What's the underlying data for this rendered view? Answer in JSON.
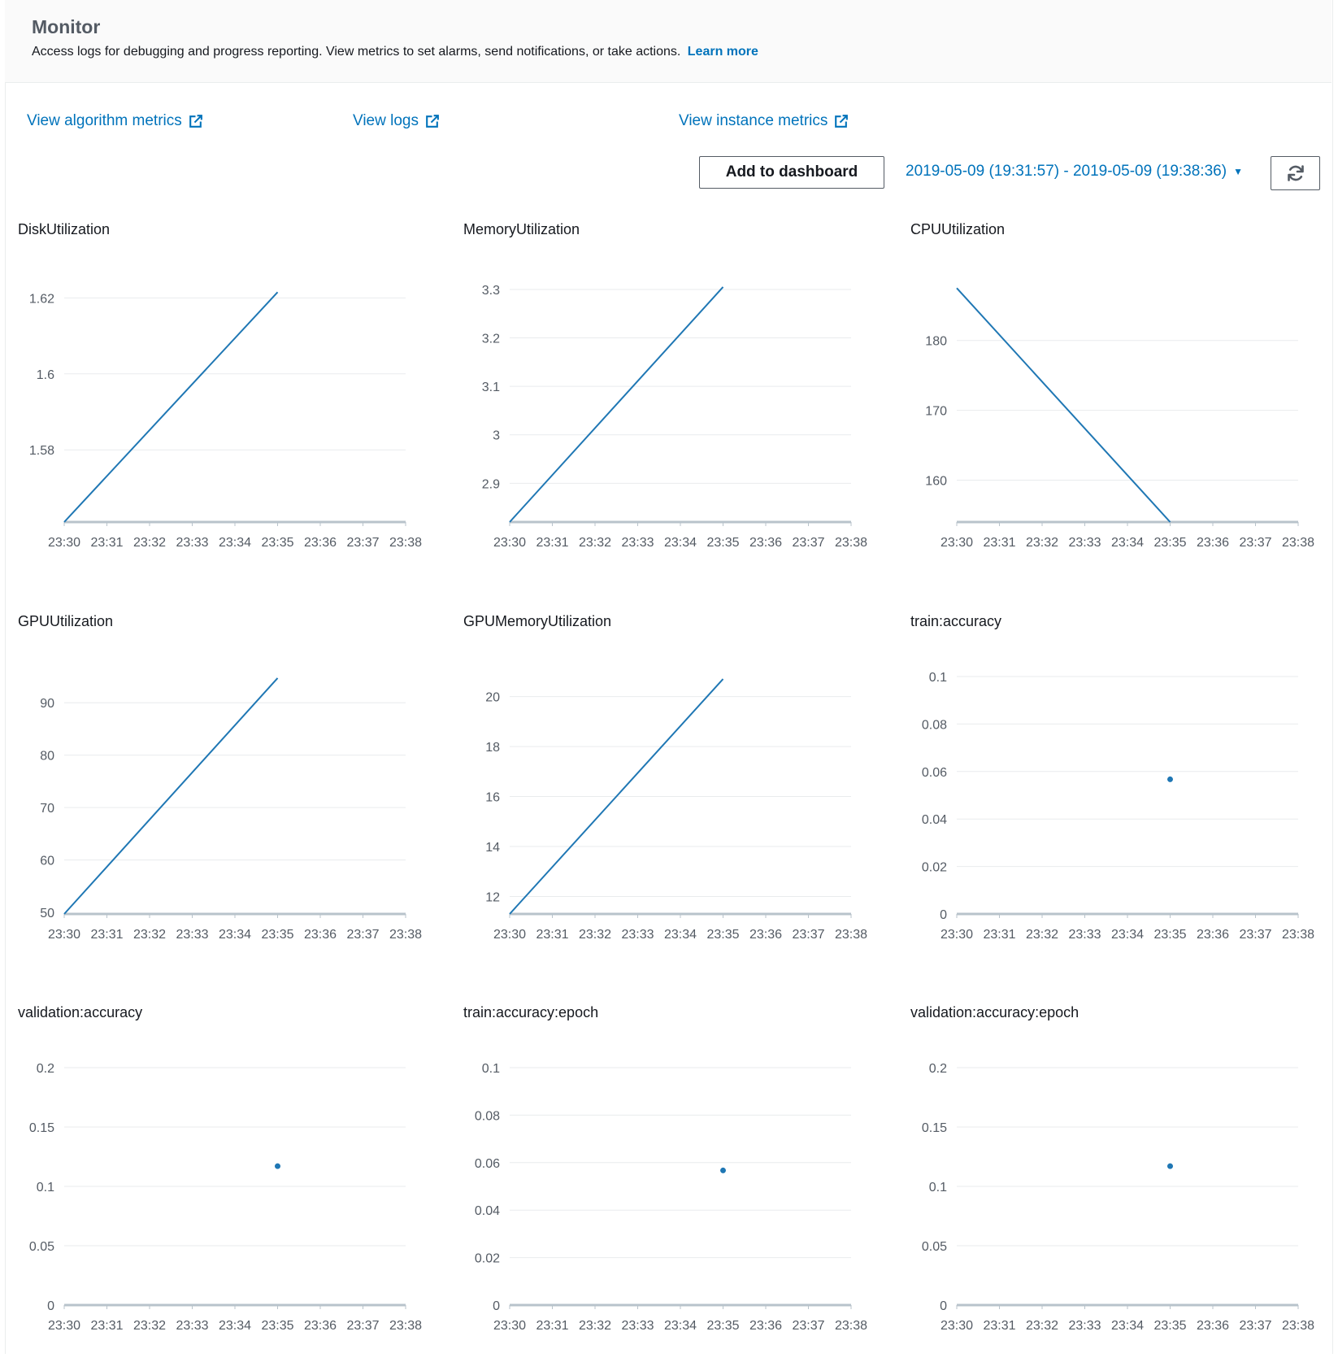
{
  "header": {
    "title": "Monitor",
    "description": "Access logs for debugging and progress reporting. View metrics to set alarms, send notifications, or take actions.",
    "learn_more": "Learn more"
  },
  "links": {
    "algorithm_metrics": "View algorithm metrics",
    "logs": "View logs",
    "instance_metrics": "View instance metrics"
  },
  "toolbar": {
    "add_to_dashboard": "Add to dashboard",
    "date_range": "2019-05-09 (19:31:57) - 2019-05-09 (19:38:36)",
    "caret_icon": "caret-down-icon",
    "refresh_icon": "refresh-icon"
  },
  "colors": {
    "accent": "#0073bb",
    "series": "#1f77b4",
    "grid": "#e9ebed",
    "axis": "#b8c3cb"
  },
  "chart_data": [
    {
      "type": "line",
      "title": "DiskUtilization",
      "x": [
        "23:30",
        "23:31",
        "23:32",
        "23:33",
        "23:34",
        "23:35",
        "23:36",
        "23:37",
        "23:38"
      ],
      "yticks": [
        "1.58",
        "1.6",
        "1.62"
      ],
      "ylim": [
        1.561,
        1.6235
      ],
      "series": [
        {
          "points": [
            [
              0,
              1.561
            ],
            [
              5,
              1.6215
            ]
          ]
        }
      ]
    },
    {
      "type": "line",
      "title": "MemoryUtilization",
      "x": [
        "23:30",
        "23:31",
        "23:32",
        "23:33",
        "23:34",
        "23:35",
        "23:36",
        "23:37",
        "23:38"
      ],
      "yticks": [
        "2.9",
        "3",
        "3.1",
        "3.2",
        "3.3"
      ],
      "ylim": [
        2.82,
        3.31
      ],
      "series": [
        {
          "points": [
            [
              0,
              2.82
            ],
            [
              5,
              3.305
            ]
          ]
        }
      ]
    },
    {
      "type": "line",
      "title": "CPUUtilization",
      "x": [
        "23:30",
        "23:31",
        "23:32",
        "23:33",
        "23:34",
        "23:35",
        "23:36",
        "23:37",
        "23:38"
      ],
      "yticks": [
        "160",
        "170",
        "180"
      ],
      "ylim": [
        154,
        188
      ],
      "series": [
        {
          "points": [
            [
              0,
              187.5
            ],
            [
              5,
              154
            ]
          ]
        }
      ]
    },
    {
      "type": "line",
      "title": "GPUUtilization",
      "x": [
        "23:30",
        "23:31",
        "23:32",
        "23:33",
        "23:34",
        "23:35",
        "23:36",
        "23:37",
        "23:38"
      ],
      "yticks": [
        "50",
        "60",
        "70",
        "80",
        "90"
      ],
      "ylim": [
        49.7,
        95
      ],
      "series": [
        {
          "points": [
            [
              0,
              49.7
            ],
            [
              5,
              94.7
            ]
          ]
        }
      ]
    },
    {
      "type": "line",
      "title": "GPUMemoryUtilization",
      "x": [
        "23:30",
        "23:31",
        "23:32",
        "23:33",
        "23:34",
        "23:35",
        "23:36",
        "23:37",
        "23:38"
      ],
      "yticks": [
        "12",
        "14",
        "16",
        "18",
        "20"
      ],
      "ylim": [
        11.3,
        20.8
      ],
      "series": [
        {
          "points": [
            [
              0,
              11.3
            ],
            [
              5,
              20.7
            ]
          ]
        }
      ]
    },
    {
      "type": "scatter",
      "title": "train:accuracy",
      "x": [
        "23:30",
        "23:31",
        "23:32",
        "23:33",
        "23:34",
        "23:35",
        "23:36",
        "23:37",
        "23:38"
      ],
      "yticks": [
        "0",
        "0.02",
        "0.04",
        "0.06",
        "0.08",
        "0.1"
      ],
      "ylim": [
        0,
        0.1
      ],
      "series": [
        {
          "points": [
            [
              5,
              0.0567
            ]
          ]
        }
      ]
    },
    {
      "type": "scatter",
      "title": "validation:accuracy",
      "x": [
        "23:30",
        "23:31",
        "23:32",
        "23:33",
        "23:34",
        "23:35",
        "23:36",
        "23:37",
        "23:38"
      ],
      "yticks": [
        "0",
        "0.05",
        "0.1",
        "0.15",
        "0.2"
      ],
      "ylim": [
        0,
        0.2
      ],
      "series": [
        {
          "points": [
            [
              5,
              0.117
            ]
          ]
        }
      ]
    },
    {
      "type": "scatter",
      "title": "train:accuracy:epoch",
      "x": [
        "23:30",
        "23:31",
        "23:32",
        "23:33",
        "23:34",
        "23:35",
        "23:36",
        "23:37",
        "23:38"
      ],
      "yticks": [
        "0",
        "0.02",
        "0.04",
        "0.06",
        "0.08",
        "0.1"
      ],
      "ylim": [
        0,
        0.1
      ],
      "series": [
        {
          "points": [
            [
              5,
              0.0567
            ]
          ]
        }
      ]
    },
    {
      "type": "scatter",
      "title": "validation:accuracy:epoch",
      "x": [
        "23:30",
        "23:31",
        "23:32",
        "23:33",
        "23:34",
        "23:35",
        "23:36",
        "23:37",
        "23:38"
      ],
      "yticks": [
        "0",
        "0.05",
        "0.1",
        "0.15",
        "0.2"
      ],
      "ylim": [
        0,
        0.2
      ],
      "series": [
        {
          "points": [
            [
              5,
              0.117
            ]
          ]
        }
      ]
    }
  ]
}
